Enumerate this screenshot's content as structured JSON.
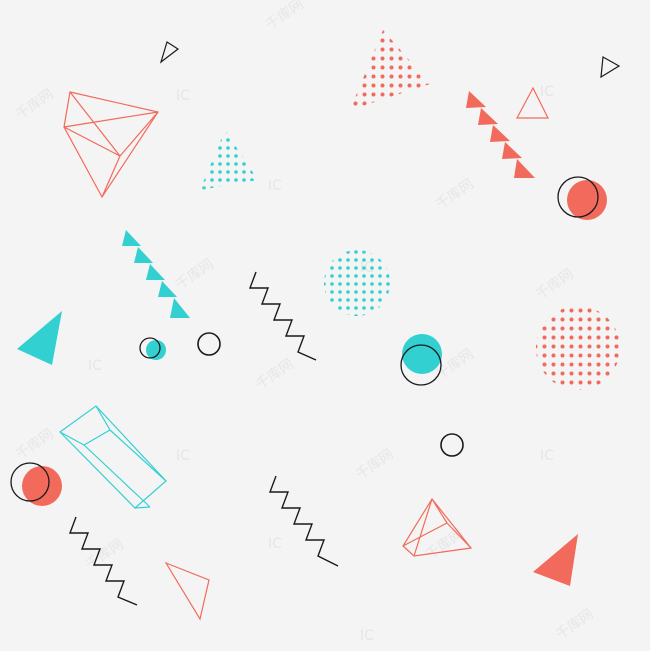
{
  "palette": {
    "background": "#f4f4f4",
    "coral": "#f26a5b",
    "cyan": "#33d0d2",
    "black": "#1a1a1a"
  },
  "watermark": {
    "text": "千库网",
    "logo_text": "IC"
  },
  "shapes": [
    "black-outline-triangle",
    "coral-dotted-triangle",
    "coral-wireframe-pyramid",
    "cyan-dotted-triangle",
    "coral-triangle-chain",
    "coral-outline-triangle",
    "coral-filled-circle",
    "black-outline-circle",
    "cyan-triangle-chain",
    "black-zigzag",
    "cyan-dotted-circle",
    "cyan-filled-triangle",
    "cyan-filled-circle",
    "coral-dotted-circle",
    "cyan-wireframe-prism",
    "coral-wireframe-triangle-prism",
    "coral-filled-triangle"
  ]
}
